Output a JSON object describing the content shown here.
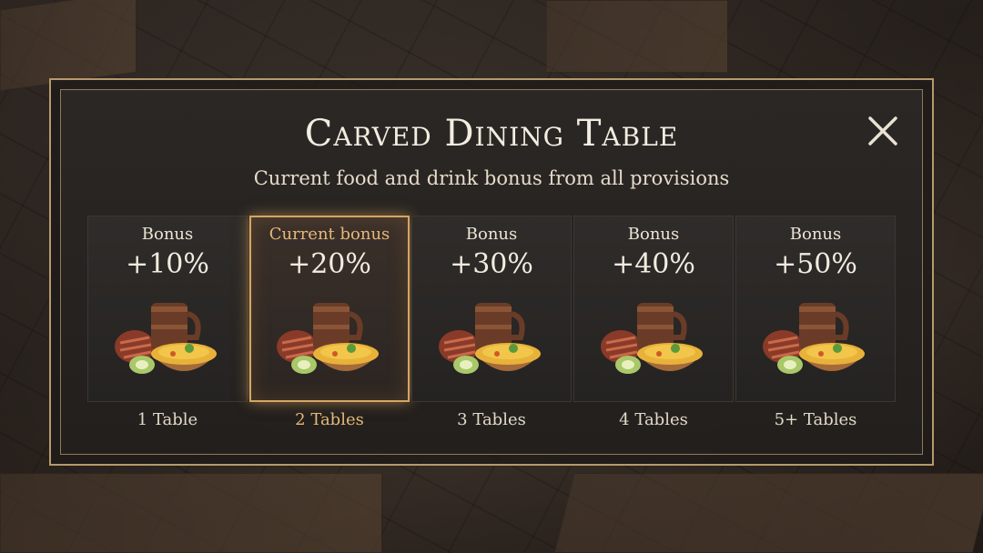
{
  "dialog": {
    "title": "Carved Dining Table",
    "subtitle": "Current food and drink bonus from all provisions",
    "close_icon": "close-icon"
  },
  "tiers": [
    {
      "label": "Bonus",
      "value": "+10%",
      "count": "1 Table",
      "current": false
    },
    {
      "label": "Current bonus",
      "value": "+20%",
      "count": "2 Tables",
      "current": true
    },
    {
      "label": "Bonus",
      "value": "+30%",
      "count": "3 Tables",
      "current": false
    },
    {
      "label": "Bonus",
      "value": "+40%",
      "count": "4 Tables",
      "current": false
    },
    {
      "label": "Bonus",
      "value": "+50%",
      "count": "5+ Tables",
      "current": false
    }
  ],
  "colors": {
    "frame": "#b59a6c",
    "highlight": "#d4a564",
    "text": "#f2ebdf"
  }
}
